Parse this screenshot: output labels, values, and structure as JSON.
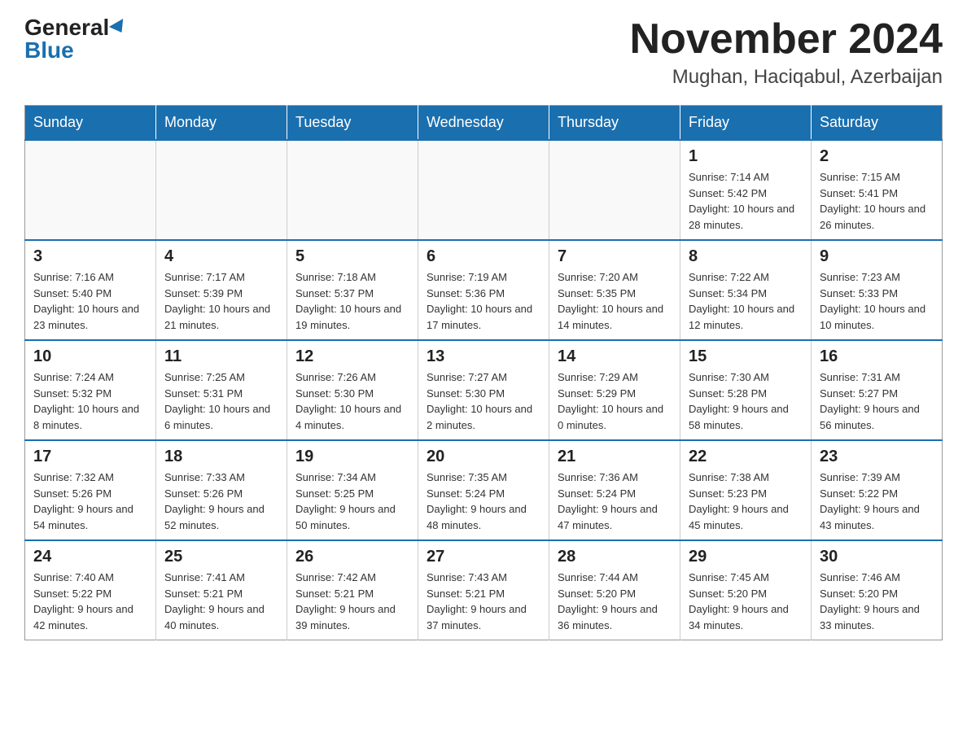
{
  "header": {
    "logo": {
      "general": "General",
      "blue": "Blue",
      "arrow": true
    },
    "title": "November 2024",
    "location": "Mughan, Haciqabul, Azerbaijan"
  },
  "calendar": {
    "weekdays": [
      "Sunday",
      "Monday",
      "Tuesday",
      "Wednesday",
      "Thursday",
      "Friday",
      "Saturday"
    ],
    "weeks": [
      [
        {
          "day": "",
          "info": ""
        },
        {
          "day": "",
          "info": ""
        },
        {
          "day": "",
          "info": ""
        },
        {
          "day": "",
          "info": ""
        },
        {
          "day": "",
          "info": ""
        },
        {
          "day": "1",
          "info": "Sunrise: 7:14 AM\nSunset: 5:42 PM\nDaylight: 10 hours and 28 minutes."
        },
        {
          "day": "2",
          "info": "Sunrise: 7:15 AM\nSunset: 5:41 PM\nDaylight: 10 hours and 26 minutes."
        }
      ],
      [
        {
          "day": "3",
          "info": "Sunrise: 7:16 AM\nSunset: 5:40 PM\nDaylight: 10 hours and 23 minutes."
        },
        {
          "day": "4",
          "info": "Sunrise: 7:17 AM\nSunset: 5:39 PM\nDaylight: 10 hours and 21 minutes."
        },
        {
          "day": "5",
          "info": "Sunrise: 7:18 AM\nSunset: 5:37 PM\nDaylight: 10 hours and 19 minutes."
        },
        {
          "day": "6",
          "info": "Sunrise: 7:19 AM\nSunset: 5:36 PM\nDaylight: 10 hours and 17 minutes."
        },
        {
          "day": "7",
          "info": "Sunrise: 7:20 AM\nSunset: 5:35 PM\nDaylight: 10 hours and 14 minutes."
        },
        {
          "day": "8",
          "info": "Sunrise: 7:22 AM\nSunset: 5:34 PM\nDaylight: 10 hours and 12 minutes."
        },
        {
          "day": "9",
          "info": "Sunrise: 7:23 AM\nSunset: 5:33 PM\nDaylight: 10 hours and 10 minutes."
        }
      ],
      [
        {
          "day": "10",
          "info": "Sunrise: 7:24 AM\nSunset: 5:32 PM\nDaylight: 10 hours and 8 minutes."
        },
        {
          "day": "11",
          "info": "Sunrise: 7:25 AM\nSunset: 5:31 PM\nDaylight: 10 hours and 6 minutes."
        },
        {
          "day": "12",
          "info": "Sunrise: 7:26 AM\nSunset: 5:30 PM\nDaylight: 10 hours and 4 minutes."
        },
        {
          "day": "13",
          "info": "Sunrise: 7:27 AM\nSunset: 5:30 PM\nDaylight: 10 hours and 2 minutes."
        },
        {
          "day": "14",
          "info": "Sunrise: 7:29 AM\nSunset: 5:29 PM\nDaylight: 10 hours and 0 minutes."
        },
        {
          "day": "15",
          "info": "Sunrise: 7:30 AM\nSunset: 5:28 PM\nDaylight: 9 hours and 58 minutes."
        },
        {
          "day": "16",
          "info": "Sunrise: 7:31 AM\nSunset: 5:27 PM\nDaylight: 9 hours and 56 minutes."
        }
      ],
      [
        {
          "day": "17",
          "info": "Sunrise: 7:32 AM\nSunset: 5:26 PM\nDaylight: 9 hours and 54 minutes."
        },
        {
          "day": "18",
          "info": "Sunrise: 7:33 AM\nSunset: 5:26 PM\nDaylight: 9 hours and 52 minutes."
        },
        {
          "day": "19",
          "info": "Sunrise: 7:34 AM\nSunset: 5:25 PM\nDaylight: 9 hours and 50 minutes."
        },
        {
          "day": "20",
          "info": "Sunrise: 7:35 AM\nSunset: 5:24 PM\nDaylight: 9 hours and 48 minutes."
        },
        {
          "day": "21",
          "info": "Sunrise: 7:36 AM\nSunset: 5:24 PM\nDaylight: 9 hours and 47 minutes."
        },
        {
          "day": "22",
          "info": "Sunrise: 7:38 AM\nSunset: 5:23 PM\nDaylight: 9 hours and 45 minutes."
        },
        {
          "day": "23",
          "info": "Sunrise: 7:39 AM\nSunset: 5:22 PM\nDaylight: 9 hours and 43 minutes."
        }
      ],
      [
        {
          "day": "24",
          "info": "Sunrise: 7:40 AM\nSunset: 5:22 PM\nDaylight: 9 hours and 42 minutes."
        },
        {
          "day": "25",
          "info": "Sunrise: 7:41 AM\nSunset: 5:21 PM\nDaylight: 9 hours and 40 minutes."
        },
        {
          "day": "26",
          "info": "Sunrise: 7:42 AM\nSunset: 5:21 PM\nDaylight: 9 hours and 39 minutes."
        },
        {
          "day": "27",
          "info": "Sunrise: 7:43 AM\nSunset: 5:21 PM\nDaylight: 9 hours and 37 minutes."
        },
        {
          "day": "28",
          "info": "Sunrise: 7:44 AM\nSunset: 5:20 PM\nDaylight: 9 hours and 36 minutes."
        },
        {
          "day": "29",
          "info": "Sunrise: 7:45 AM\nSunset: 5:20 PM\nDaylight: 9 hours and 34 minutes."
        },
        {
          "day": "30",
          "info": "Sunrise: 7:46 AM\nSunset: 5:20 PM\nDaylight: 9 hours and 33 minutes."
        }
      ]
    ]
  }
}
